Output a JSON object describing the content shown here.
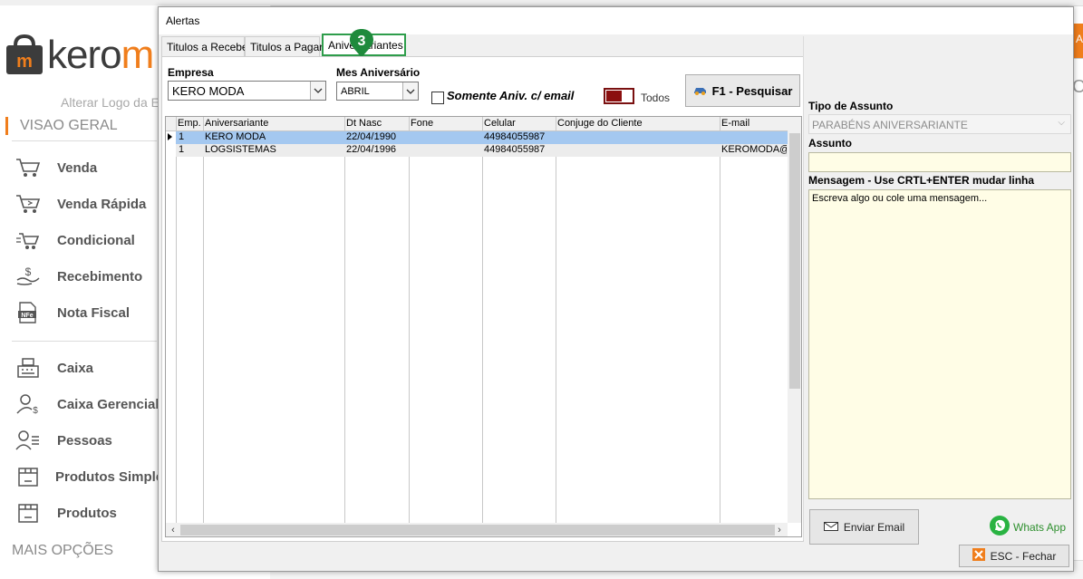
{
  "background": {
    "logo_text_left": "kero",
    "logo_text_right": "m",
    "alter_logo": "Alterar Logo da E",
    "section_title": "VISAO GERAL",
    "menu": [
      {
        "label": "Venda",
        "icon": "cart-icon"
      },
      {
        "label": "Venda Rápida",
        "icon": "cart-fast-icon"
      },
      {
        "label": "Condicional",
        "icon": "cart-swap-icon"
      },
      {
        "label": "Recebimento",
        "icon": "money-hand-icon"
      },
      {
        "label": "Nota Fiscal",
        "icon": "nfe-icon"
      },
      {
        "label": "Caixa",
        "icon": "cash-register-icon"
      },
      {
        "label": "Caixa Gerencial",
        "icon": "user-money-icon"
      },
      {
        "label": "Pessoas",
        "icon": "people-icon"
      },
      {
        "label": "Produtos Simples",
        "icon": "box-icon"
      },
      {
        "label": "Produtos",
        "icon": "box-icon"
      }
    ],
    "mais_opcoes": "MAIS OPÇÕES",
    "right_letter": "A",
    "right_c": "C"
  },
  "dialog": {
    "title": "Alertas",
    "tabs": [
      {
        "label": "Titulos a Receber",
        "active": false
      },
      {
        "label": "Titulos a Pagar",
        "active": false
      },
      {
        "label": "Aniversariantes",
        "active": true
      }
    ],
    "step_marker": "3",
    "filters": {
      "empresa_label": "Empresa",
      "empresa_value": "KERO MODA",
      "mes_label": "Mes Aniversário",
      "mes_value": "ABRIL",
      "somente_label": "Somente Aniv. c/ email",
      "somente_checked": false,
      "toggle_label": "Todos",
      "pesquisar_label": "F1 - Pesquisar"
    },
    "grid": {
      "columns": [
        "Emp.",
        "Aniversariante",
        "Dt Nasc",
        "Fone",
        "Celular",
        "Conjuge do Cliente",
        "E-mail"
      ],
      "rows": [
        {
          "emp": "1",
          "nome": "KERO MODA",
          "dt": "22/04/1990",
          "fone": "",
          "celular": "44984055987",
          "conjuge": "",
          "email": ""
        },
        {
          "emp": "1",
          "nome": "LOGSISTEMAS",
          "dt": "22/04/1996",
          "fone": "",
          "celular": "44984055987",
          "conjuge": "",
          "email": "KEROMODA@L"
        }
      ]
    },
    "right": {
      "tipo_label": "Tipo de Assunto",
      "tipo_value": "PARABÉNS ANIVERSARIANTE",
      "assunto_label": "Assunto",
      "assunto_value": "",
      "mensagem_label": "Mensagem - Use CRTL+ENTER mudar linha",
      "mensagem_placeholder": "Escreva algo ou cole uma mensagem...",
      "enviar_label": "Enviar Email",
      "whats_label": "Whats App"
    },
    "esc_label": "ESC - Fechar"
  },
  "colors": {
    "accent_orange": "#f07e1c",
    "tab_highlight": "#2e9d4b",
    "selected_row": "#a4c8f0",
    "message_bg": "#fffde6",
    "toggle": "#8b0f0f"
  }
}
